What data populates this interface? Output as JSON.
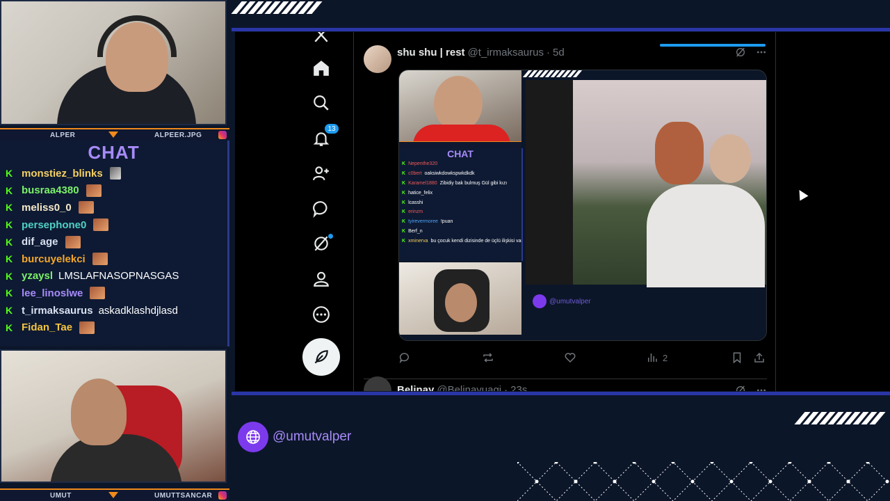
{
  "streamer_top": {
    "left_name": "ALPER",
    "right_name": "ALPEER.JPG"
  },
  "streamer_bottom": {
    "left_name": "UMUT",
    "right_name": "UMUTTSANCAR"
  },
  "chat": {
    "title": "CHAT",
    "messages": [
      {
        "user": "monstiez_blinks",
        "color": "#f5d061",
        "text": "",
        "emote": "small"
      },
      {
        "user": "busraa4380",
        "color": "#7cf06a",
        "text": "",
        "emote": "face"
      },
      {
        "user": "meliss0_0",
        "color": "#f5e9c8",
        "text": "",
        "emote": "face"
      },
      {
        "user": "persephone0",
        "color": "#4fd1c5",
        "text": "",
        "emote": "face"
      },
      {
        "user": "dif_age",
        "color": "#d8e0f0",
        "text": "",
        "emote": "face"
      },
      {
        "user": "burcuyelekci",
        "color": "#f4a72c",
        "text": "",
        "emote": "face"
      },
      {
        "user": "yzaysl",
        "color": "#7cf06a",
        "text": "LMSLAFNASOPNASGAS",
        "emote": ""
      },
      {
        "user": "lee_linoslwe",
        "color": "#a78bfa",
        "text": "",
        "emote": "face"
      },
      {
        "user": "t_irmaksaurus",
        "color": "#d8e0f0",
        "text": "askadklashdjlasd",
        "emote": ""
      },
      {
        "user": "Fidan_Tae",
        "color": "#f4c542",
        "text": "",
        "emote": "face"
      }
    ]
  },
  "twitter": {
    "notification_count": "13",
    "nav": [
      "x-logo",
      "home",
      "explore",
      "notifications",
      "communities",
      "messages",
      "grok",
      "profile",
      "more"
    ],
    "tweet": {
      "name": "shu shu | rest",
      "handle": "@t_irmaksaurus",
      "time": "5d",
      "views": "2"
    },
    "next_tweet": {
      "name": "Belinay",
      "handle": "@Belinayuagi",
      "time": "23s"
    },
    "embedded": {
      "chat_title": "CHAT",
      "handle": "@umutvalper",
      "rows": [
        {
          "user": "Nepenthe320",
          "color": "#f05a5a",
          "text": ""
        },
        {
          "user": "c0bert",
          "color": "#f05a5a",
          "text": "oaksiwkdowkspwkdkdk"
        },
        {
          "user": "Karamel1880",
          "color": "#f05a5a",
          "text": "Zibidiy bak bulmuş Gül gibi kızı"
        },
        {
          "user": "hatice_felix",
          "color": "#ffffff",
          "text": ""
        },
        {
          "user": "lcasshi",
          "color": "#ffffff",
          "text": ""
        },
        {
          "user": "erinzm",
          "color": "#f05a5a",
          "text": ""
        },
        {
          "user": "tyirevermoree",
          "color": "#4fa3f7",
          "text": "!puan"
        },
        {
          "user": "Berf_n",
          "color": "#ffffff",
          "text": ""
        },
        {
          "user": "xminerva",
          "color": "#f5d061",
          "text": "bu çocuk kendi dizisinde de üçlü ilişkisi vardı gereksiz bilgi"
        }
      ]
    }
  },
  "footer": {
    "handle": "@umutvalper"
  },
  "colors": {
    "accent": "#7c3aed",
    "band": "#2a36a8",
    "kick_green": "#53fc18",
    "twitter_blue": "#1d9bf0"
  }
}
